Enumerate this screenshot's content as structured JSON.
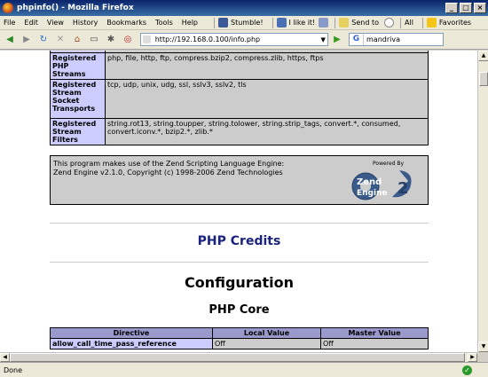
{
  "window": {
    "title": "phpinfo() - Mozilla Firefox",
    "controls": [
      "_",
      "□",
      "×"
    ]
  },
  "menubar": {
    "items": [
      "File",
      "Edit",
      "View",
      "History",
      "Bookmarks",
      "Tools",
      "Help"
    ],
    "extras": {
      "stumble": "Stumble!",
      "ilikeit": "I like it!",
      "sendto": "Send to",
      "all": "All",
      "favorites": "Favorites"
    }
  },
  "navbar": {
    "url": "http://192.168.0.100/info.php",
    "search_engine": "G",
    "search_value": "mandriva"
  },
  "streams_table": {
    "rows": [
      {
        "label": "Registered PHP Streams",
        "value": "php, file, http, ftp, compress.bzip2, compress.zlib, https, ftps"
      },
      {
        "label": "Registered Stream Socket Transports",
        "value": "tcp, udp, unix, udg, ssl, sslv3, sslv2, tls"
      },
      {
        "label": "Registered Stream Filters",
        "value": "string.rot13, string.toupper, string.tolower, string.strip_tags, convert.*, consumed, convert.iconv.*, bzip2.*, zlib.*"
      }
    ]
  },
  "zend": {
    "line1": "This program makes use of the Zend Scripting Language Engine:",
    "line2": "Zend Engine v2.1.0, Copyright (c) 1998-2006 Zend Technologies",
    "logo_powered": "Powered By",
    "logo_name": "Zend",
    "logo_engine": "Engine",
    "logo_ver": "2"
  },
  "headings": {
    "credits": "PHP Credits",
    "configuration": "Configuration",
    "core": "PHP Core"
  },
  "core_table": {
    "headers": [
      "Directive",
      "Local Value",
      "Master Value"
    ],
    "rows": [
      {
        "directive": "allow_call_time_pass_reference",
        "local": "Off",
        "master": "Off"
      }
    ]
  },
  "status": {
    "text": "Done"
  },
  "colors": {
    "label_bg": "#ccccff",
    "value_bg": "#cccccc",
    "header_bg": "#9999cc",
    "credits_link": "#1a237e"
  }
}
